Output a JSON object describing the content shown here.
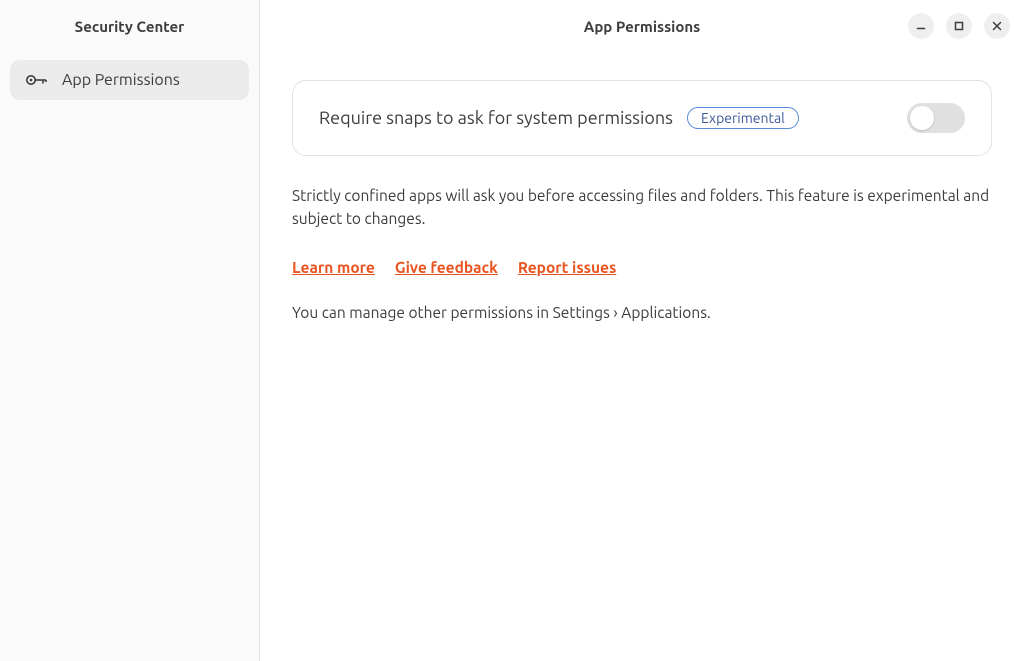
{
  "sidebar": {
    "title": "Security Center",
    "items": [
      {
        "label": "App Permissions",
        "active": true
      }
    ]
  },
  "header": {
    "title": "App Permissions"
  },
  "main": {
    "setting": {
      "label": "Require snaps to ask for system permissions",
      "badge": "Experimental",
      "toggled": false
    },
    "description": "Strictly confined apps will ask you before accessing files and folders. This feature is experimental and subject to changes.",
    "links": {
      "learn_more": "Learn more",
      "give_feedback": "Give feedback",
      "report_issues": "Report issues"
    },
    "hint": "You can manage other permissions in Settings › Applications."
  }
}
